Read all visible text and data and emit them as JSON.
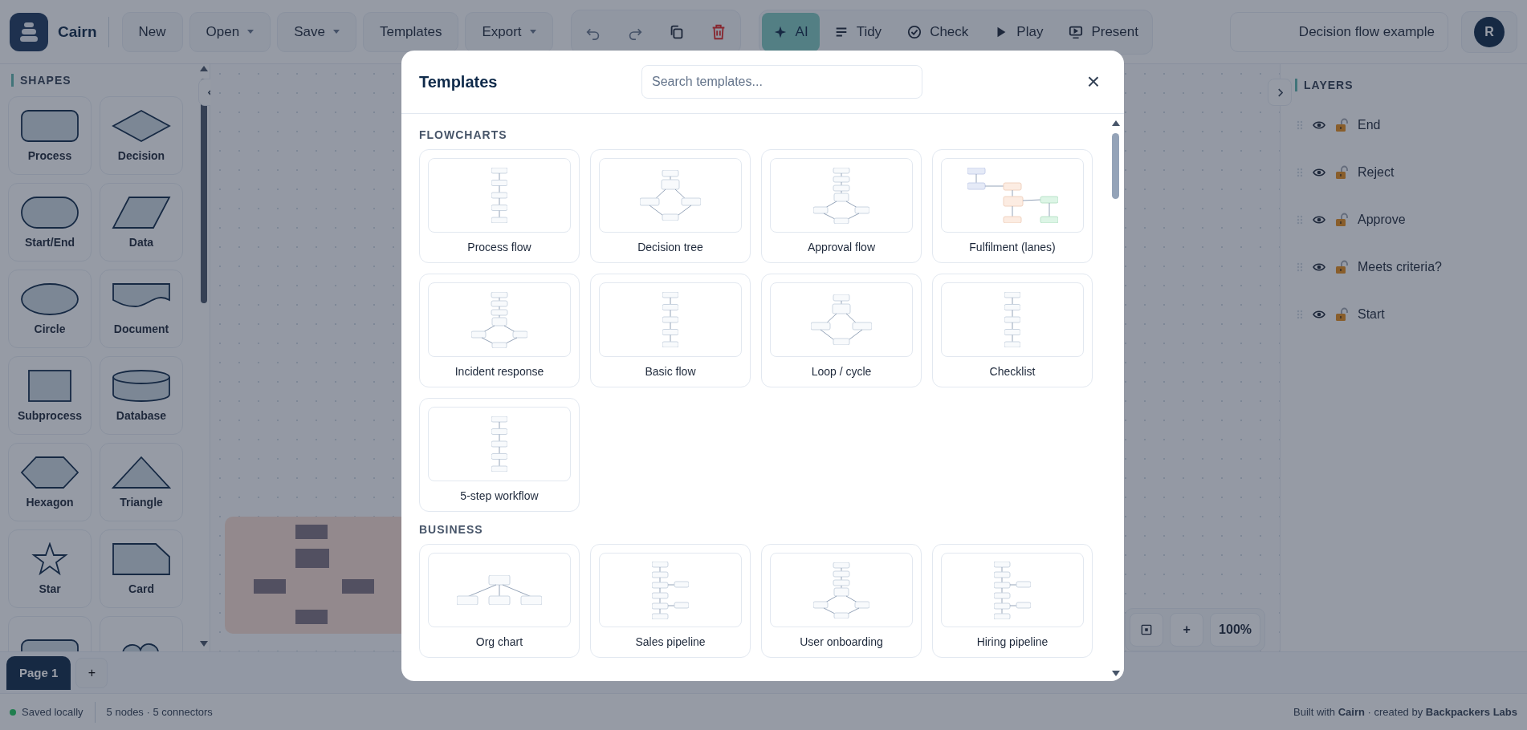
{
  "app": {
    "name": "Cairn"
  },
  "toolbar": {
    "file_buttons": [
      {
        "label": "New",
        "dropdown": false
      },
      {
        "label": "Open",
        "dropdown": true
      },
      {
        "label": "Save",
        "dropdown": true
      },
      {
        "label": "Templates",
        "dropdown": false
      },
      {
        "label": "Export",
        "dropdown": true
      }
    ],
    "edit_tools": [
      {
        "kind": "undo"
      },
      {
        "kind": "redo"
      },
      {
        "kind": "copy"
      },
      {
        "kind": "delete"
      }
    ],
    "actions": [
      {
        "label": "AI",
        "kind": "ai",
        "selected": true
      },
      {
        "label": "Tidy",
        "kind": "tidy",
        "selected": false
      },
      {
        "label": "Check",
        "kind": "check",
        "selected": false
      },
      {
        "label": "Play",
        "kind": "play",
        "selected": false
      },
      {
        "label": "Present",
        "kind": "present",
        "selected": false
      }
    ],
    "document_title": "Decision flow example",
    "avatar": "R"
  },
  "shapes_panel": {
    "title": "SHAPES",
    "shapes": [
      {
        "kind": "process",
        "label": "Process"
      },
      {
        "kind": "decision",
        "label": "Decision"
      },
      {
        "kind": "terminal",
        "label": "Start/End"
      },
      {
        "kind": "data",
        "label": "Data"
      },
      {
        "kind": "circle",
        "label": "Circle"
      },
      {
        "kind": "document",
        "label": "Document"
      },
      {
        "kind": "subprocess",
        "label": "Subprocess"
      },
      {
        "kind": "database",
        "label": "Database"
      },
      {
        "kind": "hexagon",
        "label": "Hexagon"
      },
      {
        "kind": "triangle",
        "label": "Triangle"
      },
      {
        "kind": "star",
        "label": "Star"
      },
      {
        "kind": "card",
        "label": "Card"
      },
      {
        "kind": "process"
      },
      {
        "kind": "cloud"
      }
    ]
  },
  "layers_panel": {
    "title": "LAYERS",
    "layers": [
      {
        "name": "End",
        "visible": true,
        "locked": false
      },
      {
        "name": "Reject",
        "visible": true,
        "locked": false
      },
      {
        "name": "Approve",
        "visible": true,
        "locked": false
      },
      {
        "name": "Meets criteria?",
        "visible": true,
        "locked": false
      },
      {
        "name": "Start",
        "visible": true,
        "locked": false
      }
    ]
  },
  "zoom_controls": {
    "buttons": [
      {
        "kind": "fit"
      },
      {
        "kind": "zoom-in",
        "label": "+"
      }
    ],
    "level": "100%"
  },
  "pages": {
    "tabs": [
      {
        "label": "Page 1",
        "selected": true
      }
    ],
    "add": "+"
  },
  "status_bar": {
    "saved": "Saved locally",
    "counts": "5 nodes · 5 connectors",
    "credit": "Built with **Cairn** · created by **Backpackers Labs**"
  },
  "templates_dialog": {
    "title": "Templates",
    "search": {
      "placeholder": "Search templates..."
    },
    "close": "×",
    "sections": [
      {
        "title": "FLOWCHARTS",
        "templates": [
          {
            "label": "Process flow",
            "kind": "stack"
          },
          {
            "label": "Decision tree",
            "kind": "loop"
          },
          {
            "label": "Approval flow",
            "kind": "split"
          },
          {
            "label": "Fulfilment (lanes)",
            "kind": "lanes"
          },
          {
            "label": "Incident response",
            "kind": "split"
          },
          {
            "label": "Basic flow",
            "kind": "stack"
          },
          {
            "label": "Loop / cycle",
            "kind": "loop"
          },
          {
            "label": "Checklist",
            "kind": "stack"
          },
          {
            "label": "5-step workflow",
            "kind": "stack"
          }
        ]
      },
      {
        "title": "BUSINESS",
        "templates": [
          {
            "label": "Org chart",
            "kind": "org"
          },
          {
            "label": "Sales pipeline",
            "kind": "branches"
          },
          {
            "label": "User onboarding",
            "kind": "split"
          },
          {
            "label": "Hiring pipeline",
            "kind": "branches"
          }
        ]
      }
    ]
  }
}
